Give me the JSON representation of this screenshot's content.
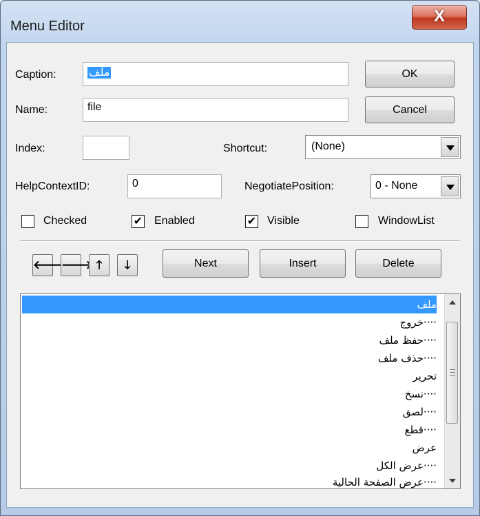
{
  "window": {
    "title": "Menu Editor",
    "close_glyph": "X"
  },
  "fields": {
    "caption_label": "Caption:",
    "caption_value": "ملف",
    "name_label": "Name:",
    "name_value": "file",
    "index_label": "Index:",
    "index_value": "",
    "shortcut_label": "Shortcut:",
    "shortcut_value": "(None)",
    "helpcontext_label": "HelpContextID:",
    "helpcontext_value": "0",
    "negotiate_label": "NegotiatePosition:",
    "negotiate_value": "0 - None"
  },
  "buttons": {
    "ok": "OK",
    "cancel": "Cancel",
    "next": "Next",
    "insert": "Insert",
    "delete": "Delete"
  },
  "arrows": {
    "left": "🡐",
    "right": "🡒",
    "up": "🡑",
    "down": "🡓"
  },
  "checkboxes": {
    "checked_label": "Checked",
    "checked": false,
    "enabled_label": "Enabled",
    "enabled": true,
    "visible_label": "Visible",
    "visible": true,
    "windowlist_label": "WindowList",
    "windowlist": false,
    "check_glyph": "✔"
  },
  "menu_list": {
    "items": [
      "ملف",
      "····خروج",
      "····حفظ ملف",
      "····حذف ملف",
      "تحرير",
      "····نسخ",
      "····لصق",
      "····قطع",
      "عرض",
      "····عرض الكل",
      "····عرض الصفحة الحالية"
    ],
    "selected_index": 0
  },
  "colors": {
    "selection": "#3399ff",
    "close_button": "#c0391f"
  },
  "icons": {
    "scroll_up": "scroll-up-arrow-icon",
    "scroll_down": "scroll-down-arrow-icon"
  }
}
